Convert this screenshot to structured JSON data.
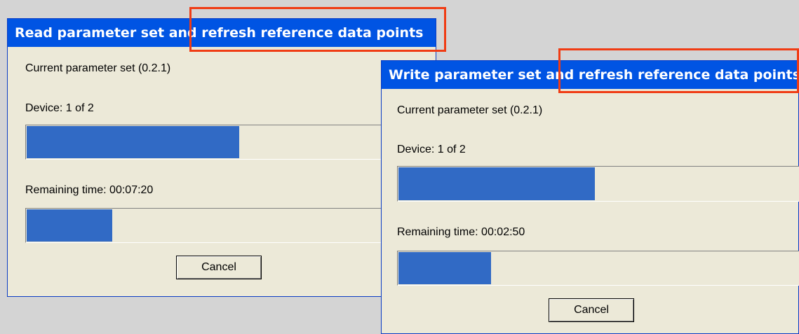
{
  "read_dialog": {
    "title": "Read parameter set and refresh reference data points",
    "parameter_set": "Current parameter set (0.2.1)",
    "device": "Device: 1 of 2",
    "device_progress": 0.52,
    "remaining_time": "Remaining time:  00:07:20",
    "time_progress": 0.21,
    "cancel_label": "Cancel"
  },
  "write_dialog": {
    "title": "Write parameter set and refresh reference data points",
    "parameter_set": "Current parameter set (0.2.1)",
    "device": "Device: 1 of 2",
    "device_progress": 0.49,
    "remaining_time": "Remaining time:  00:02:50",
    "time_progress": 0.23,
    "cancel_label": "Cancel"
  },
  "colors": {
    "titlebar": "#0054e3",
    "progress_fill": "#316ac5",
    "dialog_bg": "#ece9d8",
    "highlight": "#f03c14",
    "desktop": "#d4d4d4"
  }
}
